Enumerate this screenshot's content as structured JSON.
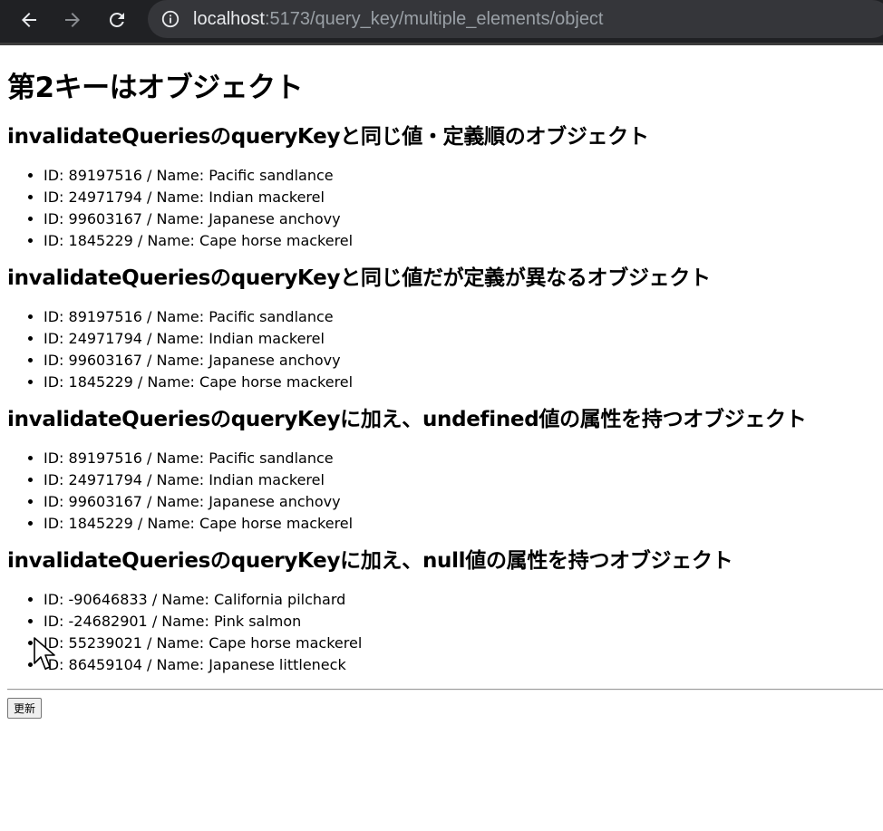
{
  "browser": {
    "url_host": "localhost",
    "url_rest": ":5173/query_key/multiple_elements/object",
    "icons": {
      "back": "arrow-left-icon",
      "forward": "arrow-right-icon",
      "reload": "reload-icon",
      "site_info": "info-icon"
    }
  },
  "page": {
    "title": "第2キーはオブジェクト",
    "sections": [
      {
        "heading": "invalidateQueriesのqueryKeyと同じ値・定義順のオブジェクト",
        "items": [
          "ID: 89197516 / Name: Pacific sandlance",
          "ID: 24971794 / Name: Indian mackerel",
          "ID: 99603167 / Name: Japanese anchovy",
          "ID: 1845229 / Name: Cape horse mackerel"
        ]
      },
      {
        "heading": "invalidateQueriesのqueryKeyと同じ値だが定義が異なるオブジェクト",
        "items": [
          "ID: 89197516 / Name: Pacific sandlance",
          "ID: 24971794 / Name: Indian mackerel",
          "ID: 99603167 / Name: Japanese anchovy",
          "ID: 1845229 / Name: Cape horse mackerel"
        ]
      },
      {
        "heading": "invalidateQueriesのqueryKeyに加え、undefined値の属性を持つオブジェクト",
        "items": [
          "ID: 89197516 / Name: Pacific sandlance",
          "ID: 24971794 / Name: Indian mackerel",
          "ID: 99603167 / Name: Japanese anchovy",
          "ID: 1845229 / Name: Cape horse mackerel"
        ]
      },
      {
        "heading": "invalidateQueriesのqueryKeyに加え、null値の属性を持つオブジェクト",
        "items": [
          "ID: -90646833 / Name: California pilchard",
          "ID: -24682901 / Name: Pink salmon",
          "ID: 55239021 / Name: Cape horse mackerel",
          "ID: 86459104 / Name: Japanese littleneck"
        ]
      }
    ],
    "refresh_label": "更新"
  }
}
